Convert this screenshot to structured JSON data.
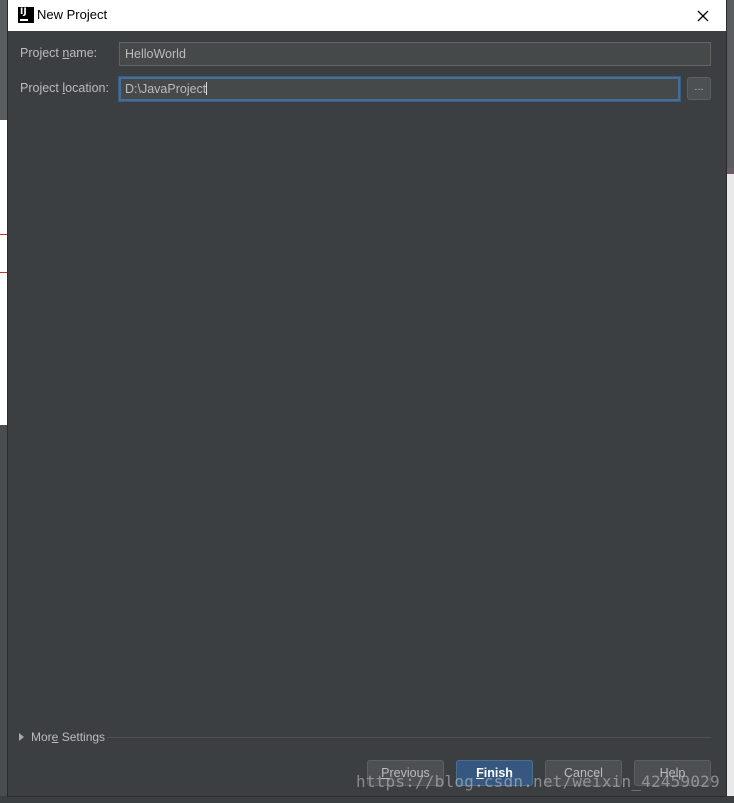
{
  "window": {
    "title": "New Project",
    "app_icon_text": "IJ"
  },
  "form": {
    "project_name_label_pre": "Project ",
    "project_name_label_mnemonic": "n",
    "project_name_label_post": "ame:",
    "project_name_value": "HelloWorld",
    "project_location_label_pre": "Project ",
    "project_location_label_mnemonic": "l",
    "project_location_label_post": "ocation:",
    "project_location_value": "D:\\JavaProject",
    "browse_label": "..."
  },
  "more_settings": {
    "label_pre": "Mor",
    "label_mnemonic": "e",
    "label_post": " Settings"
  },
  "buttons": {
    "previous_mnemonic": "P",
    "previous_rest": "revious",
    "finish_mnemonic": "F",
    "finish_rest": "inish",
    "cancel": "Cancel",
    "help": "Help"
  },
  "watermark": "https://blog.csdn.net/weixin_42459029",
  "colors": {
    "dialog_bg": "#3c3f41",
    "field_bg": "#45494a",
    "focus_border": "#466d94",
    "primary_button": "#365880"
  }
}
